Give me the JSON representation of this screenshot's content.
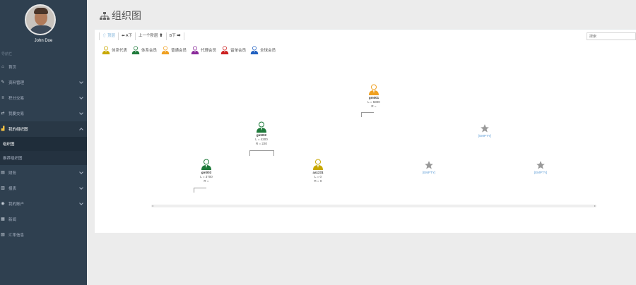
{
  "sidebar": {
    "user_name": "John Doe",
    "section_label": "导航栏",
    "items": [
      {
        "label": "首页",
        "icon": "home-icon",
        "glyph": "⌂",
        "has_children": false
      },
      {
        "label": "资料管理",
        "icon": "edit-icon",
        "glyph": "✎",
        "has_children": true
      },
      {
        "label": "积分交易",
        "icon": "list-icon",
        "glyph": "≡",
        "has_children": true
      },
      {
        "label": "我要交易",
        "icon": "exchange-icon",
        "glyph": "⇄",
        "has_children": true
      },
      {
        "label": "我的组织图",
        "icon": "sitemap-icon",
        "glyph": "▟",
        "has_children": true,
        "expanded": true
      },
      {
        "label": "财务",
        "icon": "wallet-icon",
        "glyph": "▤",
        "has_children": true
      },
      {
        "label": "报表",
        "icon": "chart-icon",
        "glyph": "▥",
        "has_children": true
      },
      {
        "label": "我的账户",
        "icon": "location-icon",
        "glyph": "◉",
        "has_children": true
      },
      {
        "label": "新闻",
        "icon": "news-icon",
        "glyph": "▦",
        "has_children": false
      },
      {
        "label": "汇率信息",
        "icon": "bar-chart-icon",
        "glyph": "▧",
        "has_children": false
      }
    ],
    "sub_items": [
      {
        "label": "组织图",
        "current": true
      },
      {
        "label": "推荐组织图",
        "current": false
      }
    ]
  },
  "page": {
    "title": "组织图"
  },
  "toolbar": {
    "buttons": [
      "⇧ 顶层",
      "⬅ A下",
      "上一个阶层 ⬆",
      "B下 ➡"
    ]
  },
  "search": {
    "placeholder": "搜索"
  },
  "legend": [
    {
      "label": "体系代表",
      "color": "#c8a800"
    },
    {
      "label": "体系会员",
      "color": "#1e7a3a"
    },
    {
      "label": "普通会员",
      "color": "#f0a020"
    },
    {
      "label": "代理会员",
      "color": "#8a2a9a"
    },
    {
      "label": "留单会员",
      "color": "#cc2020"
    },
    {
      "label": "全球会员",
      "color": "#2060c0"
    }
  ],
  "tree": {
    "root": {
      "name": "gm001",
      "l": "L = 5800",
      "r": "R =",
      "color": "#f0a020"
    },
    "left": {
      "name": "gm002",
      "l": "L = 4200",
      "r": "R = 220",
      "color": "#1e7a3a"
    },
    "left_left": {
      "name": "gm003",
      "l": "L = 3700",
      "r": "R =",
      "color": "#1e7a3a"
    },
    "left_right": {
      "name": "aa1231",
      "l": "L = 0",
      "r": "R = 0",
      "color": "#c8a800"
    },
    "empty_label": "[EMPTY]"
  }
}
